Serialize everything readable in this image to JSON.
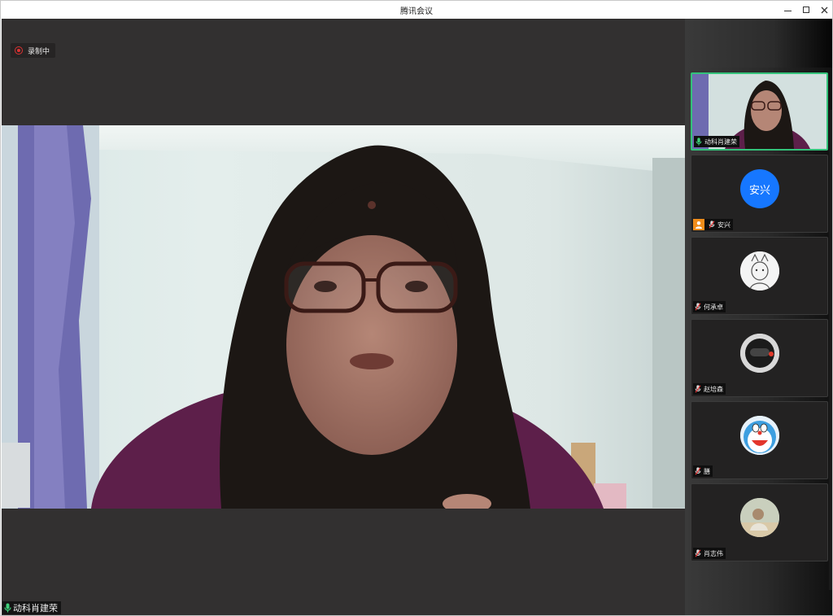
{
  "window": {
    "title": "腾讯会议",
    "controls": {
      "minimize": "—",
      "maximize": "☐",
      "close": "✕"
    }
  },
  "recording": {
    "label": "录制中",
    "icon": "record-icon",
    "color": "#dd3333"
  },
  "main_video": {
    "speaker_name": "动科肖建荣",
    "mic_icon": "mic-active-icon",
    "mic_color": "#3fd07a"
  },
  "participants": [
    {
      "name": "动科肖建荣",
      "type": "video",
      "mic": "active",
      "active_speaker": true
    },
    {
      "name": "安兴",
      "type": "text-avatar",
      "avatar_text": "安兴",
      "avatar_color": "#1677ff",
      "host": true,
      "mic": "muted"
    },
    {
      "name": "何承卓",
      "type": "image-avatar",
      "mic": "muted"
    },
    {
      "name": "赵培森",
      "type": "image-avatar",
      "mic": "muted"
    },
    {
      "name": "膳",
      "type": "image-avatar",
      "mic": "muted"
    },
    {
      "name": "肖志伟",
      "type": "image-avatar",
      "mic": "muted"
    }
  ],
  "colors": {
    "stage_bg": "#323030",
    "active_border": "#33c27a",
    "host_badge": "#f08c1a"
  }
}
